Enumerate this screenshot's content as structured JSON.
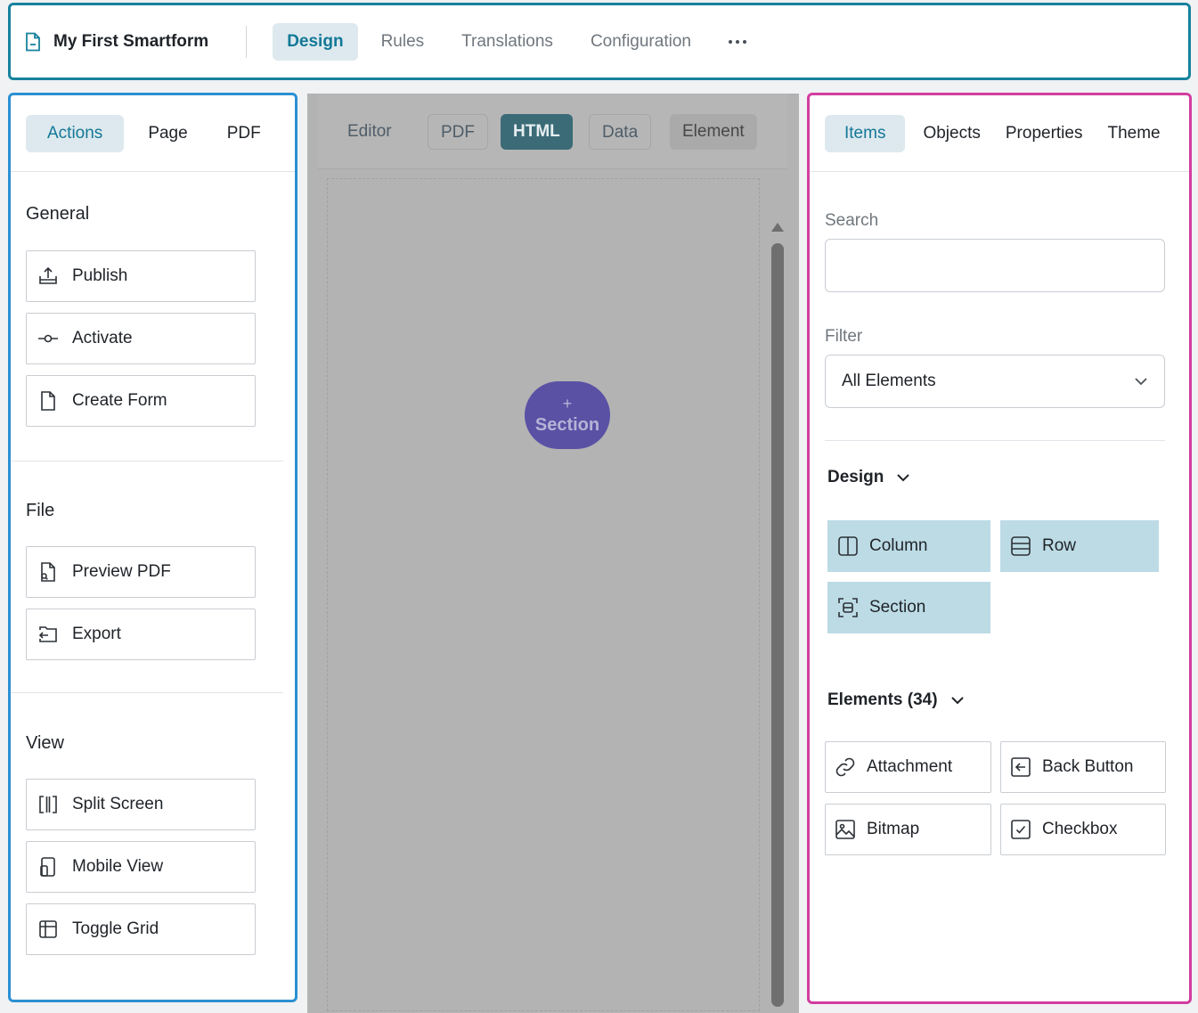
{
  "app": {
    "title": "My First Smartform",
    "title_icon": "document-icon"
  },
  "top_tabs": [
    {
      "label": "Design",
      "active": true
    },
    {
      "label": "Rules",
      "active": false
    },
    {
      "label": "Translations",
      "active": false
    },
    {
      "label": "Configuration",
      "active": false
    }
  ],
  "left_panel": {
    "tabs": [
      {
        "label": "Actions",
        "active": true
      },
      {
        "label": "Page",
        "active": false
      },
      {
        "label": "PDF",
        "active": false
      }
    ],
    "general": {
      "title": "General",
      "buttons": [
        {
          "label": "Publish",
          "icon": "upload-tray-icon"
        },
        {
          "label": "Activate",
          "icon": "commit-icon"
        },
        {
          "label": "Create Form",
          "icon": "file-icon"
        }
      ]
    },
    "file": {
      "title": "File",
      "buttons": [
        {
          "label": "Preview PDF",
          "icon": "file-preview-icon"
        },
        {
          "label": "Export",
          "icon": "folder-export-icon"
        }
      ]
    },
    "view": {
      "title": "View",
      "buttons": [
        {
          "label": "Split Screen",
          "icon": "split-screen-icon"
        },
        {
          "label": "Mobile View",
          "icon": "mobile-icon"
        },
        {
          "label": "Toggle Grid",
          "icon": "grid-icon"
        }
      ]
    }
  },
  "center": {
    "tabs": [
      {
        "label": "Editor",
        "state": "plain"
      },
      {
        "label": "PDF",
        "state": "outlined"
      },
      {
        "label": "HTML",
        "state": "active"
      },
      {
        "label": "Data",
        "state": "outlined"
      },
      {
        "label": "Element",
        "state": "shaded"
      }
    ],
    "add_section": {
      "plus": "+",
      "label": "Section"
    }
  },
  "right_panel": {
    "tabs": [
      {
        "label": "Items",
        "active": true
      },
      {
        "label": "Objects",
        "active": false
      },
      {
        "label": "Properties",
        "active": false
      },
      {
        "label": "Theme",
        "active": false
      }
    ],
    "search": {
      "label": "Search",
      "value": "",
      "placeholder": ""
    },
    "filter": {
      "label": "Filter",
      "selected": "All Elements"
    },
    "design_group": {
      "title": "Design",
      "items": [
        {
          "label": "Column",
          "icon": "column-icon"
        },
        {
          "label": "Row",
          "icon": "row-icon"
        },
        {
          "label": "Section",
          "icon": "section-icon"
        }
      ]
    },
    "elements_group": {
      "title": "Elements (34)",
      "items": [
        {
          "label": "Attachment",
          "icon": "link-icon"
        },
        {
          "label": "Back Button",
          "icon": "back-button-icon"
        },
        {
          "label": "Bitmap",
          "icon": "image-icon"
        },
        {
          "label": "Checkbox",
          "icon": "checkbox-icon"
        }
      ]
    }
  },
  "colors": {
    "header_border": "#17829e",
    "left_border": "#2a90d4",
    "right_border": "#d23da0",
    "accent": "#137897",
    "active_tab_bg": "#dde9ee",
    "design_tile_bg": "#bcdbe5",
    "section_button_bg": "#5a51a5",
    "html_tab_bg": "#3b6b77"
  }
}
